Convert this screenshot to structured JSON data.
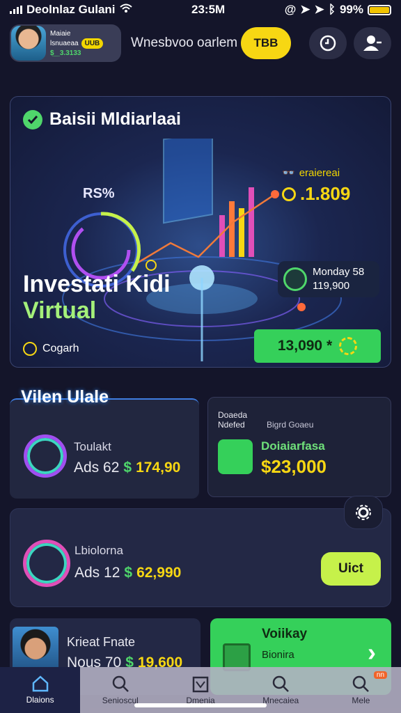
{
  "status": {
    "carrier": "Deolnlaz Gulani",
    "time": "23:5M",
    "battery": "99%",
    "battery_level": 0.99
  },
  "topbar": {
    "pill_line1": "Maiaie",
    "pill_line2": "lsnuaeaa",
    "pill_badge": "UUB",
    "pill_amount": "$̲ ̲ ̲ 3.3133",
    "title": "Wnesbvoo oarlem",
    "yellow_button": "TBB"
  },
  "hero": {
    "title": "Baisii Mldiarlaai",
    "ring_label": "RS%",
    "stat1_label": "eraiereai",
    "stat1_value": ".1.809",
    "stat2_line1": "Monday 58",
    "stat2_line2": "119,900",
    "headline": "Investati Kidi",
    "headline2": "Virtual",
    "footer": "Cogarh",
    "cta": "13,090 *"
  },
  "section": {
    "title": "Vilen Ulale"
  },
  "card_a": {
    "label": "Toulakt",
    "prefix": "Ads 62",
    "currency": "$",
    "value": "174,90"
  },
  "card_b": {
    "header_line1": "Doaeda",
    "header_line2": "Ndefed",
    "header_right": "Bigrd Goaeu",
    "label": "Doiaiarfasa",
    "value": "$23,000"
  },
  "card_c": {
    "label": "Lbiolorna",
    "prefix": "Ads 12",
    "currency": "$",
    "value": "62,990",
    "button": "Uict"
  },
  "card_d": {
    "label": "Krieat Fnate",
    "prefix": "Nous 70",
    "currency": "$",
    "value": "19,600"
  },
  "card_e": {
    "label": "Voiikay",
    "sub": "Bionira",
    "icon_text": "nn"
  },
  "tabs": [
    {
      "label": "Dlaions",
      "icon": "home-icon"
    },
    {
      "label": "Senioscul",
      "icon": "search-icon"
    },
    {
      "label": "Dmenia",
      "icon": "calendar-icon"
    },
    {
      "label": "Mnecaiea",
      "icon": "search-icon"
    },
    {
      "label": "Mele",
      "icon": "search-icon",
      "badge": "nn"
    }
  ],
  "colors": {
    "background": "#14152a",
    "green": "#35d05a",
    "yellow": "#f7d713",
    "lime": "#c6f14a"
  }
}
